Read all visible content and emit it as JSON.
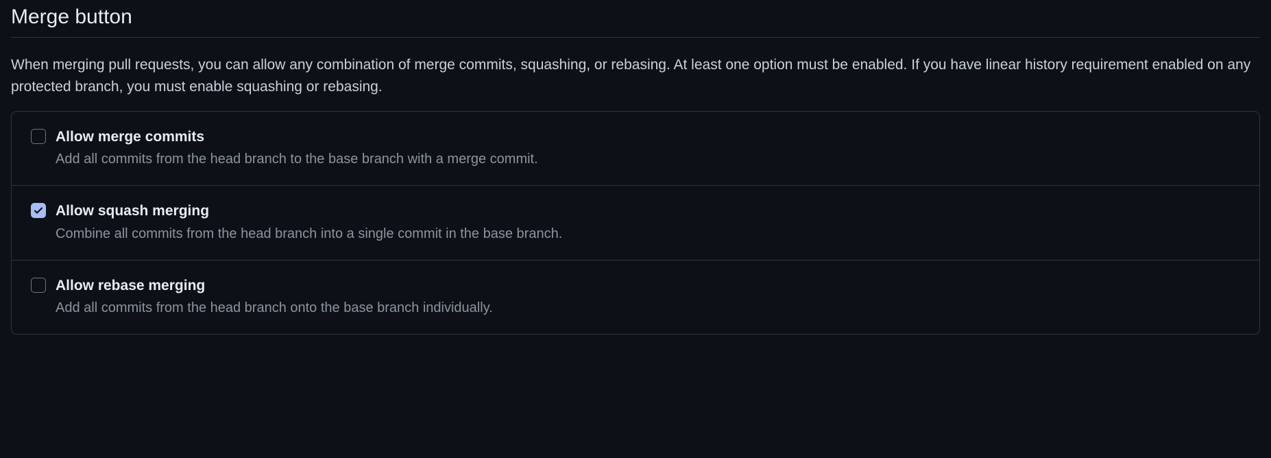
{
  "section": {
    "title": "Merge button",
    "description": "When merging pull requests, you can allow any combination of merge commits, squashing, or rebasing. At least one option must be enabled. If you have linear history requirement enabled on any protected branch, you must enable squashing or rebasing."
  },
  "options": [
    {
      "label": "Allow merge commits",
      "description": "Add all commits from the head branch to the base branch with a merge commit.",
      "checked": false
    },
    {
      "label": "Allow squash merging",
      "description": "Combine all commits from the head branch into a single commit in the base branch.",
      "checked": true
    },
    {
      "label": "Allow rebase merging",
      "description": "Add all commits from the head branch onto the base branch individually.",
      "checked": false
    }
  ]
}
